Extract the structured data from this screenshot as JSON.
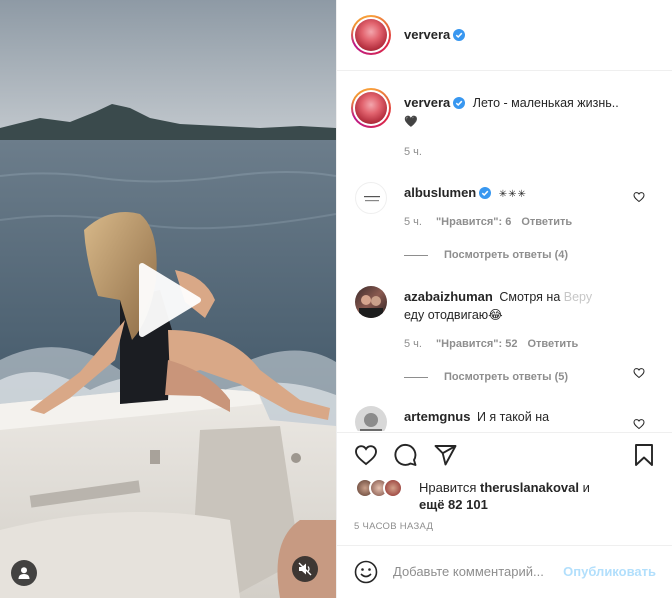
{
  "post": {
    "username": "ververa",
    "caption_text": "Лето - маленькая жизнь..",
    "caption_emoji": "🖤",
    "caption_time": "5 ч.",
    "likes_prefix": "Нравится",
    "likes_user": "theruslanakoval",
    "likes_and": "и",
    "likes_more": "ещё 82 101",
    "time_ago": "5 ЧАСОВ НАЗАД"
  },
  "comments": [
    {
      "username": "albuslumen",
      "text": "✳✳✳",
      "time": "5 ч.",
      "likes": "\"Нравится\": 6",
      "reply": "Ответить",
      "view_replies": "Посмотреть ответы (4)",
      "verified": true
    },
    {
      "username": "azabaizhuman",
      "text_line1": "Смотря на",
      "text_line1_tail": "Веру",
      "text_line2": "еду отодвигаю😂",
      "time": "5 ч.",
      "likes": "\"Нравится\": 52",
      "reply": "Ответить",
      "view_replies": "Посмотреть ответы (5)"
    },
    {
      "username": "artemgnus",
      "text": "И я такой на"
    }
  ],
  "add_comment": {
    "placeholder": "Добавьте комментарий...",
    "post_label": "Опубликовать"
  },
  "icons": {
    "like": "heart-icon",
    "comment": "comment-icon",
    "share": "paper-plane-icon",
    "save": "bookmark-icon",
    "emoji": "emoji-icon",
    "play": "play-icon",
    "user_tag": "user-icon",
    "mute": "muted-speaker-icon"
  },
  "colors": {
    "verified_blue": "#3897f0",
    "post_button": "#b2dffc",
    "meta_gray": "#8e8e8e"
  }
}
